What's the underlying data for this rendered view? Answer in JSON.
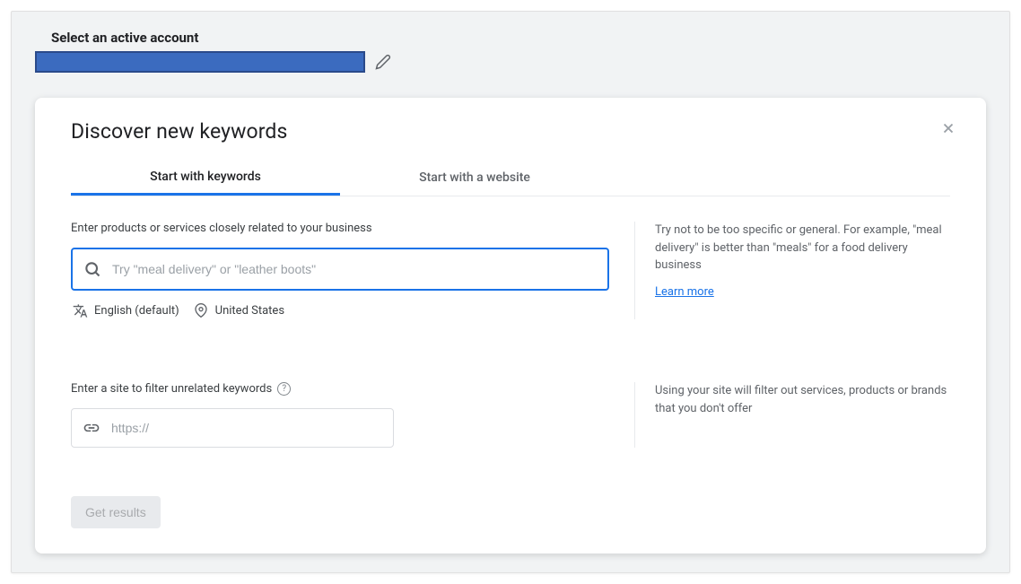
{
  "header": {
    "account_label": "Select an active account"
  },
  "card": {
    "title": "Discover new keywords",
    "tabs": [
      {
        "label": "Start with keywords"
      },
      {
        "label": "Start with a website"
      }
    ],
    "keyword_section": {
      "label": "Enter products or services closely related to your business",
      "placeholder": "Try \"meal delivery\" or \"leather boots\"",
      "language": "English (default)",
      "location": "United States",
      "tip": "Try not to be too specific or general. For example, \"meal delivery\" is better than \"meals\" for a food delivery business",
      "learn_more": "Learn more"
    },
    "site_section": {
      "label": "Enter a site to filter unrelated keywords",
      "placeholder": "https://",
      "tip": "Using your site will filter out services, products or brands that you don't offer"
    },
    "results_button": "Get results"
  }
}
